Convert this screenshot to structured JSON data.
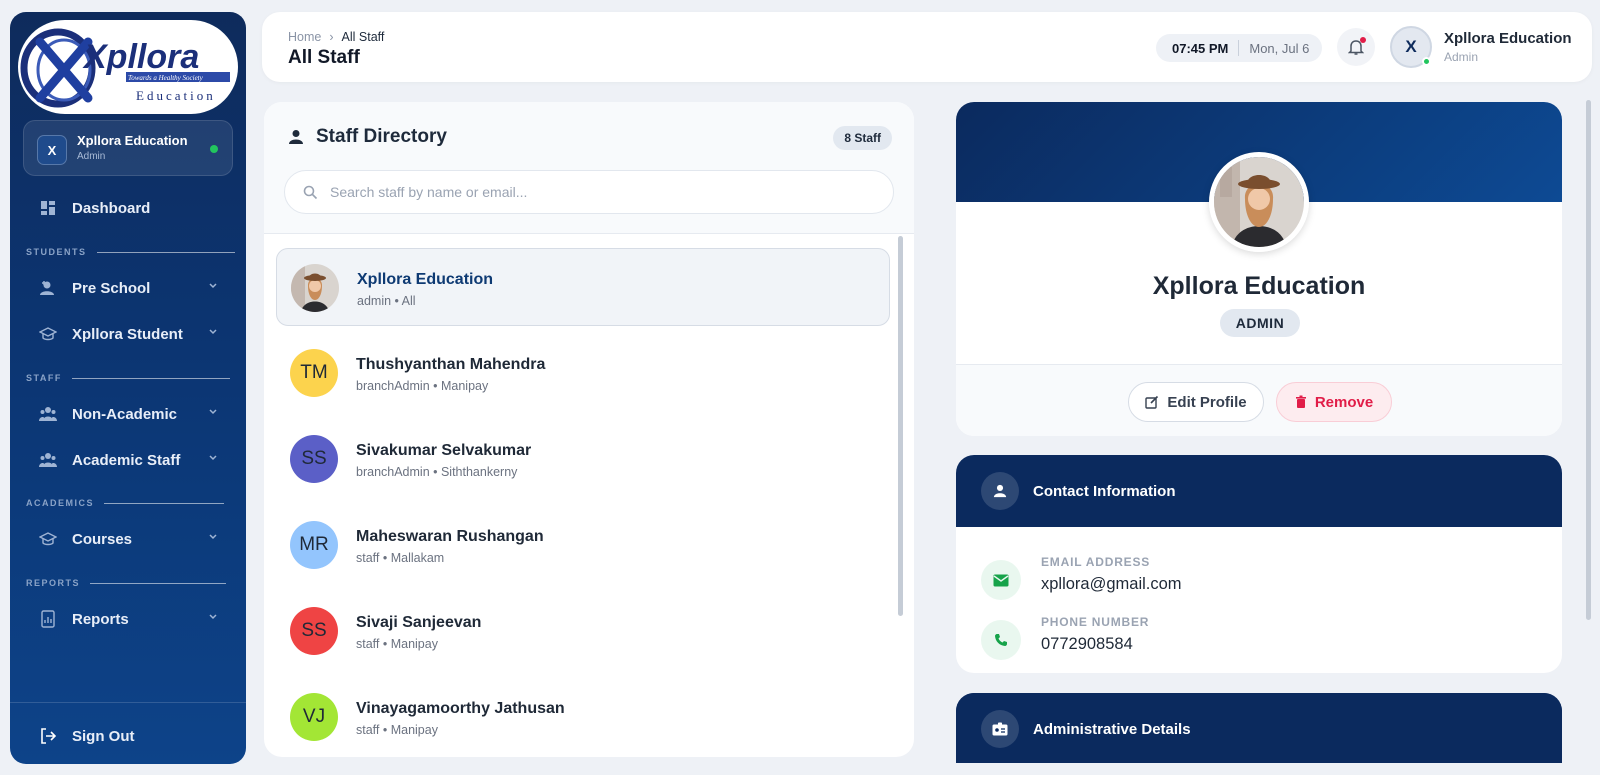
{
  "brand": {
    "logo_text": "Xpllora",
    "logo_tagline": "Towards a Healthy Society",
    "logo_sub": "Education"
  },
  "sidebar": {
    "user": {
      "initial": "X",
      "name": "Xpllora Education",
      "role": "Admin"
    },
    "dashboard": {
      "label": "Dashboard",
      "icon": "dashboard-icon"
    },
    "sections": [
      {
        "label": "STUDENTS",
        "items": [
          {
            "label": "Pre School",
            "icon": "user-plus-icon"
          },
          {
            "label": "Xpllora Student",
            "icon": "graduation-cap-icon"
          }
        ]
      },
      {
        "label": "STAFF",
        "items": [
          {
            "label": "Non-Academic",
            "icon": "users-icon"
          },
          {
            "label": "Academic Staff",
            "icon": "users-icon"
          }
        ]
      },
      {
        "label": "ACADEMICS",
        "items": [
          {
            "label": "Courses",
            "icon": "graduation-cap-icon"
          }
        ]
      },
      {
        "label": "REPORTS",
        "items": [
          {
            "label": "Reports",
            "icon": "report-icon"
          }
        ]
      }
    ],
    "sign_out": "Sign Out"
  },
  "topbar": {
    "breadcrumb": [
      "Home",
      "All Staff"
    ],
    "title": "All Staff",
    "time": "07:45 PM",
    "date": "Mon, Jul 6",
    "user": {
      "initial": "X",
      "name": "Xpllora Education",
      "role": "Admin"
    }
  },
  "directory": {
    "title": "Staff Directory",
    "count": "8 Staff",
    "search_placeholder": "Search staff by name or email...",
    "staff": [
      {
        "initials": "",
        "name": "Xpllora Education",
        "meta": "admin • All",
        "color": "#f1f4f8",
        "photo": true,
        "selected": true
      },
      {
        "initials": "TM",
        "name": "Thushyanthan Mahendra",
        "meta": "branchAdmin • Manipay",
        "color": "#fcd34d"
      },
      {
        "initials": "SS",
        "name": "Sivakumar Selvakumar",
        "meta": "branchAdmin • Siththankerny",
        "color": "#5b5fc7"
      },
      {
        "initials": "MR",
        "name": "Maheswaran Rushangan",
        "meta": "staff • Mallakam",
        "color": "#93c5fd"
      },
      {
        "initials": "SS",
        "name": "Sivaji Sanjeevan",
        "meta": "staff • Manipay",
        "color": "#ef4444"
      },
      {
        "initials": "VJ",
        "name": "Vinayagamoorthy Jathusan",
        "meta": "staff • Manipay",
        "color": "#a3e635"
      }
    ]
  },
  "profile": {
    "name": "Xpllora Education",
    "role": "ADMIN",
    "edit_label": "Edit Profile",
    "remove_label": "Remove"
  },
  "contact": {
    "title": "Contact Information",
    "email_label": "EMAIL ADDRESS",
    "email": "xpllora@gmail.com",
    "phone_label": "PHONE NUMBER",
    "phone": "0772908584"
  },
  "admin_details": {
    "title": "Administrative Details"
  },
  "colors": {
    "sidebar_top": "#0e2b5c",
    "sidebar_bottom": "#0d4389",
    "accent_navy": "#0b2a5e",
    "remove_red": "#e11d48",
    "online_green": "#22c55e"
  }
}
